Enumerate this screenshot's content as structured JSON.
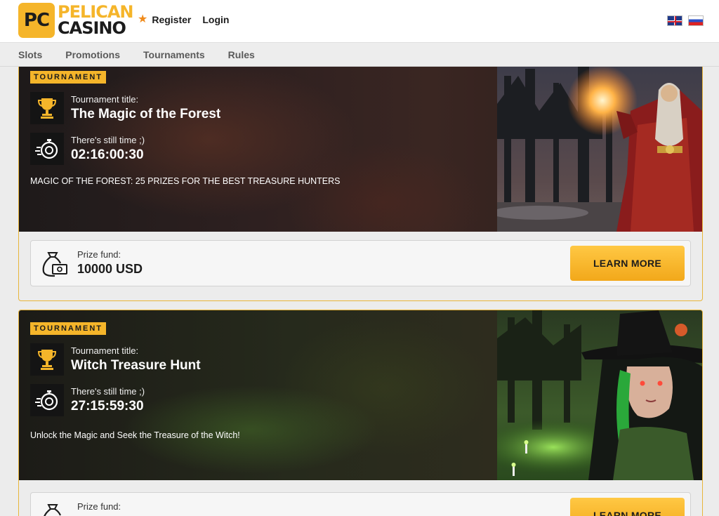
{
  "header": {
    "logo_badge": "PC",
    "logo_line1": "PELICAN",
    "logo_line2": "CASINO",
    "register_label": "Register",
    "login_label": "Login",
    "languages": [
      "english-flag",
      "russian-flag"
    ]
  },
  "nav": {
    "items": [
      {
        "label": "Slots"
      },
      {
        "label": "Promotions"
      },
      {
        "label": "Tournaments"
      },
      {
        "label": "Rules"
      }
    ]
  },
  "tournaments": [
    {
      "tag": "TOURNAMENT",
      "title_label": "Tournament title:",
      "title": "The Magic of the Forest",
      "time_label": "There's still time ;)",
      "countdown": "02:16:00:30",
      "description": "MAGIC OF THE FOREST: 25 PRIZES FOR THE BEST TREASURE HUNTERS",
      "prize_label": "Prize fund:",
      "prize_value": "10000 USD",
      "button_label": "LEARN MORE",
      "art": "wizard-casting-fire-in-dark-forest"
    },
    {
      "tag": "TOURNAMENT",
      "title_label": "Tournament title:",
      "title": "Witch Treasure Hunt",
      "time_label": "There's still time ;)",
      "countdown": "27:15:59:30",
      "description": "Unlock the Magic and Seek the Treasure of the Witch!",
      "prize_label": "Prize fund:",
      "prize_value": "",
      "button_label": "LEARN MORE",
      "art": "green-eyed-witch-in-swamp"
    }
  ],
  "colors": {
    "accent": "#f5b52a",
    "button": "#f2a81a",
    "star": "#f08a1a",
    "card_border": "#e8b53a"
  },
  "icons": {
    "trophy": "trophy-icon",
    "timer": "stopwatch-icon",
    "prize": "money-bag-icon",
    "star": "star-icon"
  }
}
